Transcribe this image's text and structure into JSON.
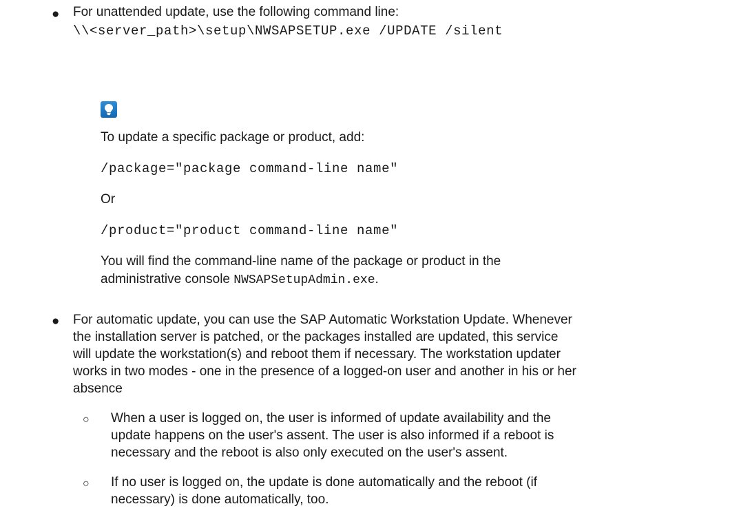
{
  "bullets": {
    "b1": {
      "text": "For unattended update, use the following command line:",
      "command": "\\\\<server_path>\\setup\\NWSAPSETUP.exe /UPDATE /silent"
    },
    "tip": {
      "icon": "lightbulb-icon",
      "intro": "To update a specific package or product, add:",
      "package_arg": "/package=\"package command-line name\"",
      "or": "Or",
      "product_arg": "/product=\"product command-line name\"",
      "find_line1": "You will find the command-line name of the package or product in the",
      "find_line2_pre": "administrative console ",
      "find_line2_code": "NWSAPSetupAdmin.exe",
      "find_line2_post": "."
    },
    "b2": {
      "lines": [
        "For automatic update, you can use the SAP Automatic Workstation Update. Whenever",
        "the installation server is patched, or the packages installed are updated, this service",
        "will update the workstation(s) and reboot them if necessary. The workstation updater",
        "works in two modes - one in the presence of a logged-on user and another in his or her",
        "absence"
      ]
    },
    "sub1": {
      "lines": [
        "When a user is logged on, the user is informed of update availability and the",
        "update happens on the user's assent. The user is also informed if a reboot is",
        "necessary and the reboot is also only executed on the user's assent."
      ]
    },
    "sub2": {
      "lines": [
        "If no user is logged on, the update is done automatically and the reboot (if",
        "necessary) is done automatically, too."
      ]
    }
  }
}
